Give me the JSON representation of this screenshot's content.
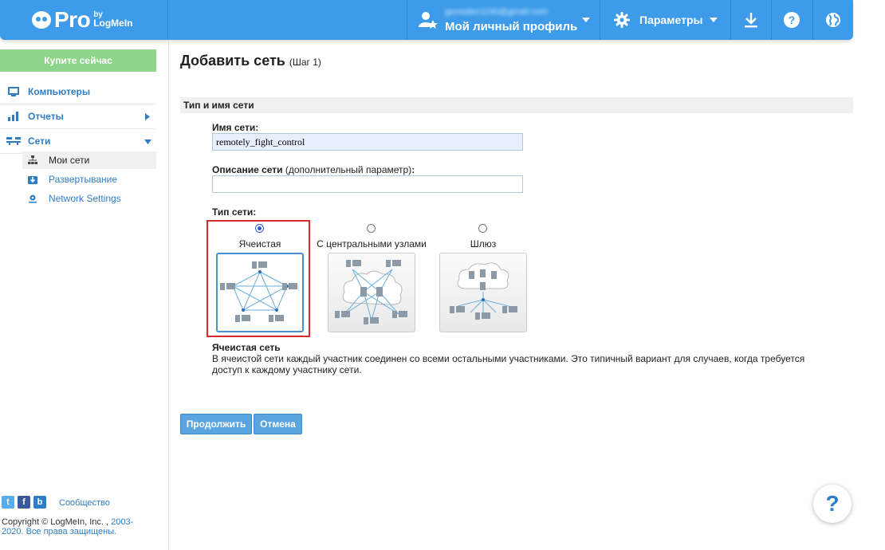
{
  "header": {
    "logo_text": "Pro",
    "logo_by": "by",
    "logo_brand": "LogMeIn",
    "profile_email": "gonsalez1190@gmail.com",
    "profile_label": "Мой личный профиль",
    "settings_label": "Параметры"
  },
  "sidebar": {
    "buy_label": "Купите сейчас",
    "items": [
      {
        "label": "Компьютеры"
      },
      {
        "label": "Отчеты"
      },
      {
        "label": "Сети"
      }
    ],
    "subitems": [
      {
        "label": "Мои сети"
      },
      {
        "label": "Развертывание"
      },
      {
        "label": "Network Settings"
      }
    ],
    "community_label": "Сообщество",
    "copyright_text": "Copyright © LogMeIn, Inc. ,",
    "copyright_years": "2003-2020.",
    "rights_text": "Все права защищены."
  },
  "main": {
    "title": "Добавить сеть",
    "step": "(Шаг 1)",
    "section_title": "Тип и имя сети",
    "name_label": "Имя сети:",
    "name_value": "remotely_fight_control",
    "desc_label": "Описание сети",
    "desc_optional": "(дополнительный параметр)",
    "desc_colon": ":",
    "desc_value": "",
    "type_label": "Тип сети:",
    "types": [
      {
        "label": "Ячеистая",
        "selected": true
      },
      {
        "label": "С центральными узлами",
        "selected": false
      },
      {
        "label": "Шлюз",
        "selected": false
      }
    ],
    "selected_title": "Ячеистая сеть",
    "selected_desc": "В ячеистой сети каждый участник соединен со всеми остальными участниками. Это типичный вариант для случаев, когда требуется доступ к каждому участнику сети.",
    "continue_label": "Продолжить",
    "cancel_label": "Отмена"
  },
  "help_label": "?",
  "colors": {
    "header_bg": "#3d9be9",
    "buy_bg": "#8ed48a",
    "link": "#2e7ec7",
    "highlight_border": "#d42a2a"
  }
}
